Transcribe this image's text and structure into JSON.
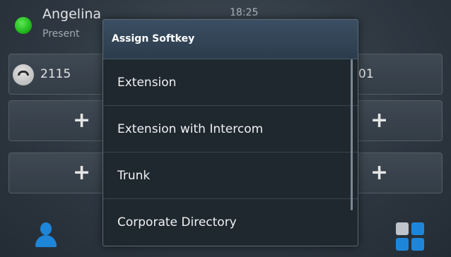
{
  "status_bar": {
    "user_name": "Angelina",
    "presence": "Present",
    "time": "18:25",
    "presence_color": "#2ecc2a"
  },
  "keys": {
    "left_extension": "2115",
    "right_extension_partial": "01",
    "add_symbol": "+"
  },
  "dialog": {
    "title": "Assign Softkey",
    "options": [
      "Extension",
      "Extension with Intercom",
      "Trunk",
      "Corporate Directory"
    ]
  },
  "bottom_bar": {
    "icons": [
      "contacts-icon",
      "apps-grid-icon"
    ],
    "accent_color": "#1f8ee6"
  }
}
